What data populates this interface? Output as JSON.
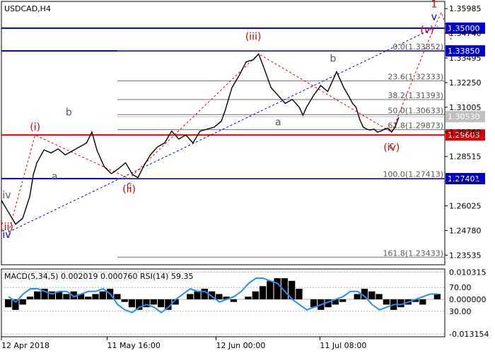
{
  "chart_data": {
    "type": "line",
    "title": "USDCAD,H4",
    "symbol": "USDCAD",
    "timeframe": "H4",
    "ylim": [
      1.2305,
      1.3635
    ],
    "y_ticks": [
      "1.35985",
      "1.34740",
      "1.33495",
      "1.32250",
      "1.31005",
      "1.29760",
      "1.28515",
      "1.27270",
      "1.26025",
      "1.24780",
      "1.23535"
    ],
    "x_ticks": [
      {
        "label": "12 Apr 2018",
        "t": 0.0
      },
      {
        "label": "11 May 16:00",
        "t": 0.298
      },
      {
        "label": "12 Jun 00:00",
        "t": 0.605
      },
      {
        "label": "11 Jul 08:00",
        "t": 0.898
      }
    ],
    "current_price": "1.30530",
    "price_path": [
      [
        0.0,
        1.263
      ],
      [
        0.02,
        1.257
      ],
      [
        0.04,
        1.251
      ],
      [
        0.06,
        1.254
      ],
      [
        0.08,
        1.265
      ],
      [
        0.09,
        1.276
      ],
      [
        0.1,
        1.282
      ],
      [
        0.12,
        1.2885
      ],
      [
        0.14,
        1.287
      ],
      [
        0.16,
        1.289
      ],
      [
        0.18,
        1.286
      ],
      [
        0.2,
        1.288
      ],
      [
        0.22,
        1.29
      ],
      [
        0.24,
        1.292
      ],
      [
        0.255,
        1.2975
      ],
      [
        0.27,
        1.288
      ],
      [
        0.29,
        1.28
      ],
      [
        0.31,
        1.2765
      ],
      [
        0.33,
        1.279
      ],
      [
        0.35,
        1.282
      ],
      [
        0.37,
        1.276
      ],
      [
        0.385,
        1.2745
      ],
      [
        0.4,
        1.28
      ],
      [
        0.42,
        1.286
      ],
      [
        0.44,
        1.29
      ],
      [
        0.46,
        1.292
      ],
      [
        0.48,
        1.298
      ],
      [
        0.5,
        1.294
      ],
      [
        0.52,
        1.296
      ],
      [
        0.54,
        1.292
      ],
      [
        0.56,
        1.298
      ],
      [
        0.58,
        1.299
      ],
      [
        0.6,
        1.3
      ],
      [
        0.62,
        1.303
      ],
      [
        0.63,
        1.308
      ],
      [
        0.65,
        1.32
      ],
      [
        0.67,
        1.326
      ],
      [
        0.69,
        1.333
      ],
      [
        0.71,
        1.334
      ],
      [
        0.725,
        1.337
      ],
      [
        0.74,
        1.33
      ],
      [
        0.76,
        1.32
      ],
      [
        0.78,
        1.316
      ],
      [
        0.8,
        1.312
      ],
      [
        0.82,
        1.314
      ],
      [
        0.84,
        1.31
      ],
      [
        0.85,
        1.306
      ],
      [
        0.86,
        1.31
      ],
      [
        0.88,
        1.316
      ],
      [
        0.9,
        1.321
      ],
      [
        0.92,
        1.318
      ],
      [
        0.935,
        1.324
      ],
      [
        0.945,
        1.328
      ],
      [
        0.955,
        1.324
      ],
      [
        0.965,
        1.32
      ],
      [
        0.975,
        1.317
      ],
      [
        0.99,
        1.312
      ],
      [
        1.0,
        1.31
      ],
      [
        1.01,
        1.304
      ],
      [
        1.02,
        1.3
      ],
      [
        1.03,
        1.299
      ],
      [
        1.04,
        1.2985
      ],
      [
        1.05,
        1.299
      ],
      [
        1.06,
        1.2975
      ],
      [
        1.07,
        1.298
      ],
      [
        1.08,
        1.299
      ],
      [
        1.09,
        1.2995
      ],
      [
        1.1,
        1.2975
      ],
      [
        1.11,
        1.3
      ],
      [
        1.12,
        1.305
      ]
    ],
    "levels": [
      {
        "price": 1.35,
        "label": "1.35000",
        "color": "#0000cc",
        "style": "blue"
      },
      {
        "price": 1.3385,
        "label": "1.33850",
        "color": "#0000cc",
        "style": "blue"
      },
      {
        "price": 1.29603,
        "label": "1.29603",
        "color": "#dd0000",
        "style": "red"
      },
      {
        "price": 1.27401,
        "label": "1.27401",
        "color": "#0000cc",
        "style": "blue"
      }
    ],
    "fib_levels": [
      {
        "price": 1.33852,
        "label": "0.0(1.33852)"
      },
      {
        "price": 1.32333,
        "label": "23.6(1.32333)"
      },
      {
        "price": 1.31393,
        "label": "38.2(1.31393)"
      },
      {
        "price": 1.30633,
        "label": "50.0(1.30633)"
      },
      {
        "price": 1.29873,
        "label": "61.8(1.29873)"
      },
      {
        "price": 1.27413,
        "label": "100.0(1.27413)"
      },
      {
        "price": 1.23433,
        "label": "161.8(1.23433)"
      }
    ],
    "wave_labels": [
      {
        "text": "iv",
        "t": 0.015,
        "price": 1.264,
        "color": "#555555"
      },
      {
        "text": "(ii)",
        "t": 0.015,
        "price": 1.248,
        "color": "#dd0000"
      },
      {
        "text": "iv",
        "t": 0.015,
        "price": 1.244,
        "color": "#0000cc"
      },
      {
        "text": "(i)",
        "t": 0.095,
        "price": 1.2985,
        "color": "#dd0000"
      },
      {
        "text": "b",
        "t": 0.19,
        "price": 1.306,
        "color": "#555555"
      },
      {
        "text": "a",
        "t": 0.15,
        "price": 1.2735,
        "color": "#555555"
      },
      {
        "text": "c",
        "t": 0.36,
        "price": 1.269,
        "color": "#555555"
      },
      {
        "text": "(ii)",
        "t": 0.36,
        "price": 1.267,
        "color": "#dd0000"
      },
      {
        "text": "(iii)",
        "t": 0.71,
        "price": 1.344,
        "color": "#dd0000"
      },
      {
        "text": "a",
        "t": 0.78,
        "price": 1.301,
        "color": "#555555"
      },
      {
        "text": "b",
        "t": 0.935,
        "price": 1.333,
        "color": "#555555"
      },
      {
        "text": "c",
        "t": 1.1,
        "price": 1.289,
        "color": "#555555"
      },
      {
        "text": "(iv)",
        "t": 1.1,
        "price": 1.288,
        "color": "#dd0000"
      },
      {
        "text": "(v)",
        "t": 1.2,
        "price": 1.3475,
        "color": "#dd0000"
      },
      {
        "text": "v",
        "t": 1.22,
        "price": 1.354,
        "color": "#0000cc"
      },
      {
        "text": "1",
        "t": 1.22,
        "price": 1.3605,
        "color": "#dd0000"
      }
    ],
    "macd_panel": {
      "label": "MACD(5,34,5) 0.002019 0.000760 RSI(14) 59.35",
      "ylim": [
        -0.0142,
        0.0115
      ],
      "ticks": [
        {
          "label": "0.010315",
          "value": 0.010315
        },
        {
          "label": "70.00",
          "value": 0.0045
        },
        {
          "label": "0.000000",
          "value": 0.0
        },
        {
          "label": "30.00",
          "value": -0.0045
        },
        {
          "label": "-0.013154",
          "value": -0.013154
        }
      ],
      "histogram": [
        -0.003,
        -0.004,
        -0.002,
        0.001,
        0.003,
        0.004,
        0.003,
        0.003,
        0.002,
        0.003,
        0.002,
        0.001,
        0.002,
        0.003,
        0.004,
        0.002,
        -0.001,
        -0.003,
        -0.004,
        -0.003,
        -0.002,
        -0.003,
        -0.004,
        -0.002,
        0.0,
        0.002,
        0.003,
        0.004,
        0.003,
        0.002,
        0.001,
        -0.001,
        0.0,
        0.001,
        0.003,
        0.005,
        0.007,
        0.008,
        0.008,
        0.007,
        0.004,
        0.0,
        -0.003,
        -0.004,
        -0.003,
        -0.002,
        -0.001,
        0.0,
        0.002,
        0.004,
        0.003,
        0.002,
        -0.002,
        -0.004,
        -0.003,
        -0.002,
        -0.001,
        -0.002,
        0.0,
        0.002
      ],
      "rsi_path": [
        0.001,
        -0.001,
        0.002,
        0.004,
        0.004,
        0.003,
        0.002,
        0.003,
        0.003,
        0.001,
        0.002,
        0.003,
        0.003,
        0.004,
        0.002,
        -0.002,
        -0.004,
        -0.005,
        -0.003,
        -0.002,
        -0.003,
        -0.005,
        -0.003,
        0.0,
        0.002,
        0.004,
        0.003,
        0.003,
        0.001,
        -0.001,
        0.0,
        0.001,
        0.003,
        0.006,
        0.008,
        0.008,
        0.007,
        0.006,
        0.003,
        0.0,
        -0.002,
        -0.004,
        -0.003,
        -0.002,
        -0.001,
        0.0,
        0.001,
        0.003,
        0.003,
        0.001,
        -0.002,
        -0.004,
        -0.003,
        -0.002,
        -0.002,
        -0.001,
        0.0,
        0.001,
        0.002,
        0.002
      ]
    }
  }
}
